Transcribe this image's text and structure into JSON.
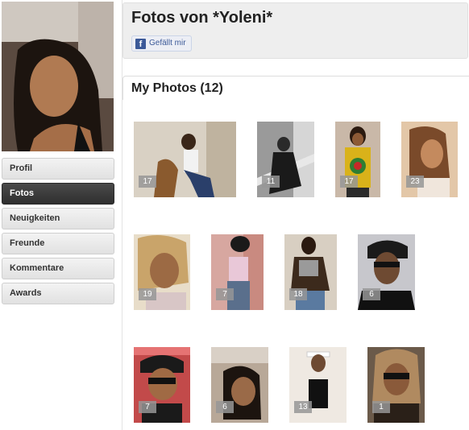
{
  "profile": {
    "title": "Fotos von *Yoleni*",
    "like_label": "Gefällt mir",
    "like_icon": "facebook-icon"
  },
  "nav": {
    "items": [
      {
        "label": "Profil",
        "active": false
      },
      {
        "label": "Fotos",
        "active": true
      },
      {
        "label": "Neuigkeiten",
        "active": false
      },
      {
        "label": "Freunde",
        "active": false
      },
      {
        "label": "Kommentare",
        "active": false
      },
      {
        "label": "Awards",
        "active": false
      }
    ]
  },
  "photos": {
    "section_title": "My Photos (12)",
    "albums": [
      {
        "count": "17"
      },
      {
        "count": "11"
      },
      {
        "count": "17"
      },
      {
        "count": "23"
      },
      {
        "count": "19"
      },
      {
        "count": "7"
      },
      {
        "count": "18"
      },
      {
        "count": "6"
      },
      {
        "count": "7"
      },
      {
        "count": "6"
      },
      {
        "count": "13"
      },
      {
        "count": "1"
      }
    ]
  },
  "colors": {
    "active_nav": "#333333",
    "header_bg": "#eeeeee",
    "facebook_blue": "#3b5998"
  }
}
